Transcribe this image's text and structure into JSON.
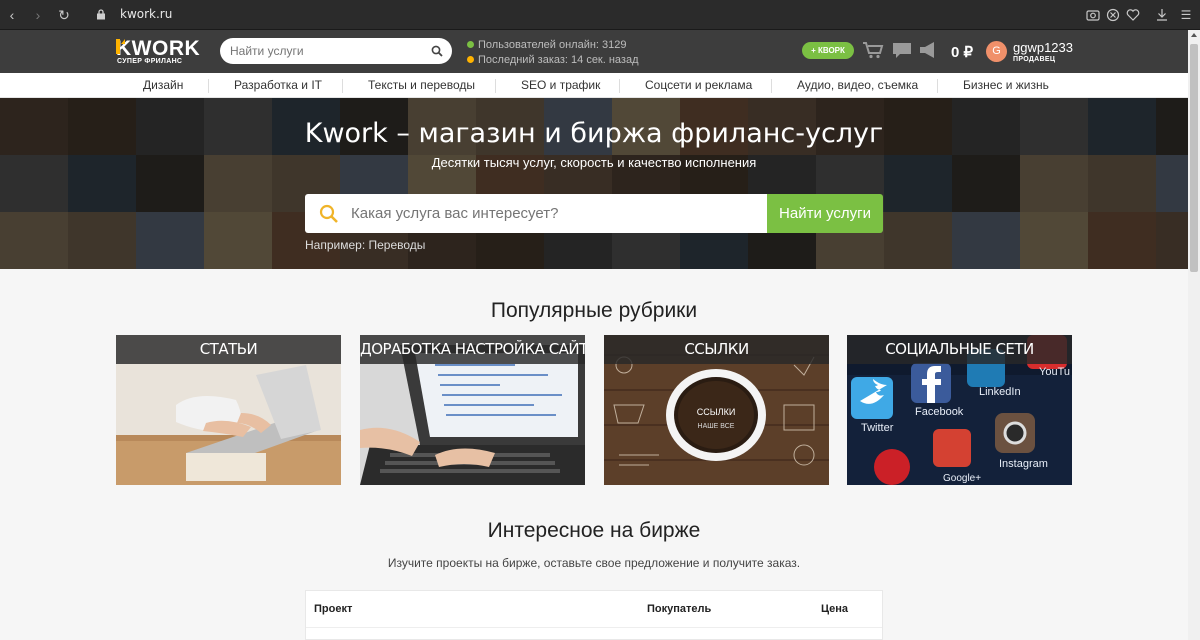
{
  "browser": {
    "url": "kwork.ru"
  },
  "header": {
    "logo_text": "KWORK",
    "logo_sub": "СУПЕР ФРИЛАНС",
    "search_placeholder": "Найти услуги",
    "online_label": "Пользователей онлайн: 3129",
    "last_order_label": "Последний заказ: 14 сек. назад",
    "add_kwork_label": "+ КВОРК",
    "balance": "0 ₽",
    "avatar_letter": "G",
    "username": "ggwp1233",
    "role": "ПРОДАВЕЦ"
  },
  "categories": [
    "Дизайн",
    "Разработка и IT",
    "Тексты и переводы",
    "SEO и трафик",
    "Соцсети и реклама",
    "Аудио, видео, съемка",
    "Бизнес и жизнь"
  ],
  "hero": {
    "title": "Kwork – магазин и биржа фриланс-услуг",
    "subtitle": "Десятки тысяч услуг, скорость и качество исполнения",
    "search_placeholder": "Какая услуга вас интересует?",
    "search_button": "Найти услуги",
    "example": "Например: Переводы"
  },
  "popular": {
    "title": "Популярные рубрики",
    "cards": [
      "СТАТЬИ",
      "ДОРАБОТКА НАСТРОЙКА САЙТА",
      "ССЫЛКИ",
      "СОЦИАЛЬНЫЕ СЕТИ"
    ],
    "card_art_text": {
      "links_cup": [
        "ССЫЛКИ",
        "НАШЕ ВСЕ"
      ],
      "social": [
        "Twitter",
        "Facebook",
        "LinkedIn",
        "YouTu",
        "Instagram",
        "Google+"
      ]
    }
  },
  "exchange": {
    "title": "Интересное на бирже",
    "subtitle": "Изучите проекты на бирже, оставьте свое предложение и получите заказ.",
    "columns": [
      "Проект",
      "Покупатель",
      "Цена"
    ]
  },
  "colors": {
    "accent_green": "#7bc043",
    "header_bg": "#3d3d3d",
    "logo_orange": "#ffb300",
    "online_dot": "#7bc043",
    "order_dot": "#ffb300"
  }
}
